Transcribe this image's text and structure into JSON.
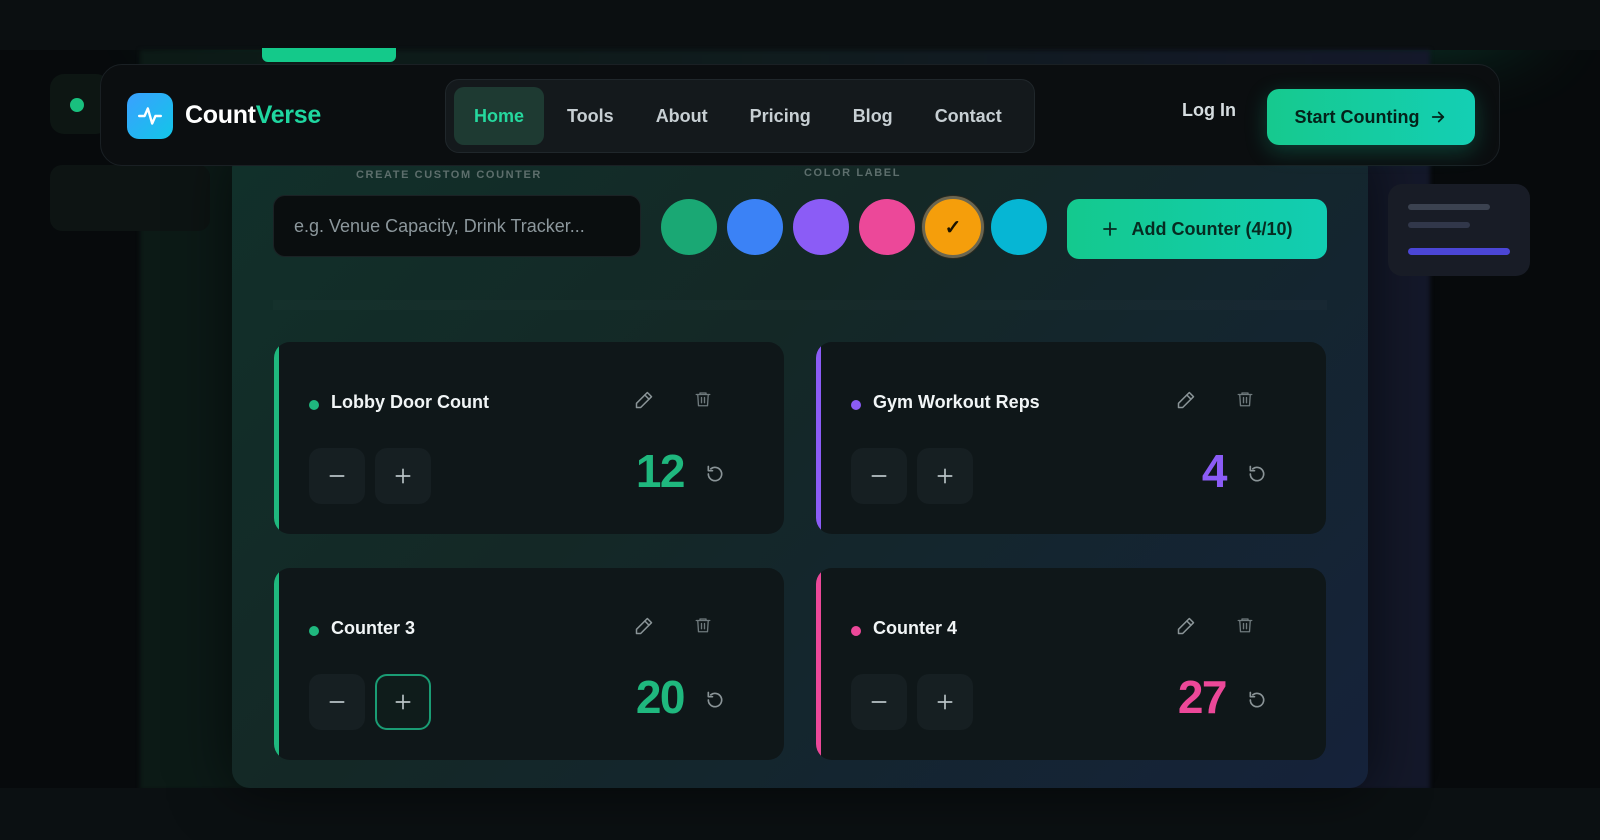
{
  "brand": {
    "part1": "Count",
    "part2": "Verse",
    "accent_color": "#1fd6a0"
  },
  "nav": {
    "links": [
      "Home",
      "Tools",
      "About",
      "Pricing",
      "Blog",
      "Contact"
    ],
    "active": "Home",
    "login_label": "Log In",
    "cta_label": "Start Counting"
  },
  "form": {
    "section_label": "CREATE CUSTOM COUNTER",
    "input_placeholder": "e.g. Venue Capacity, Drink Tracker...",
    "color_label": "COLOR LABEL",
    "colors": [
      "#1aa874",
      "#3b82f6",
      "#8b5cf6",
      "#ec4899",
      "#f59e0b",
      "#06b6d4"
    ],
    "selected_color": "#f59e0b",
    "selected_mark": "✓",
    "add_button_label": "Add Counter (4/10)"
  },
  "counters": [
    {
      "name": "Lobby Door Count",
      "value": "12",
      "color": "#1fb87e"
    },
    {
      "name": "Gym Workout Reps",
      "value": "4",
      "color": "#8b5cf6"
    },
    {
      "name": "Counter 3",
      "value": "20",
      "color": "#1fb87e"
    },
    {
      "name": "Counter 4",
      "value": "27",
      "color": "#ec4899"
    }
  ]
}
